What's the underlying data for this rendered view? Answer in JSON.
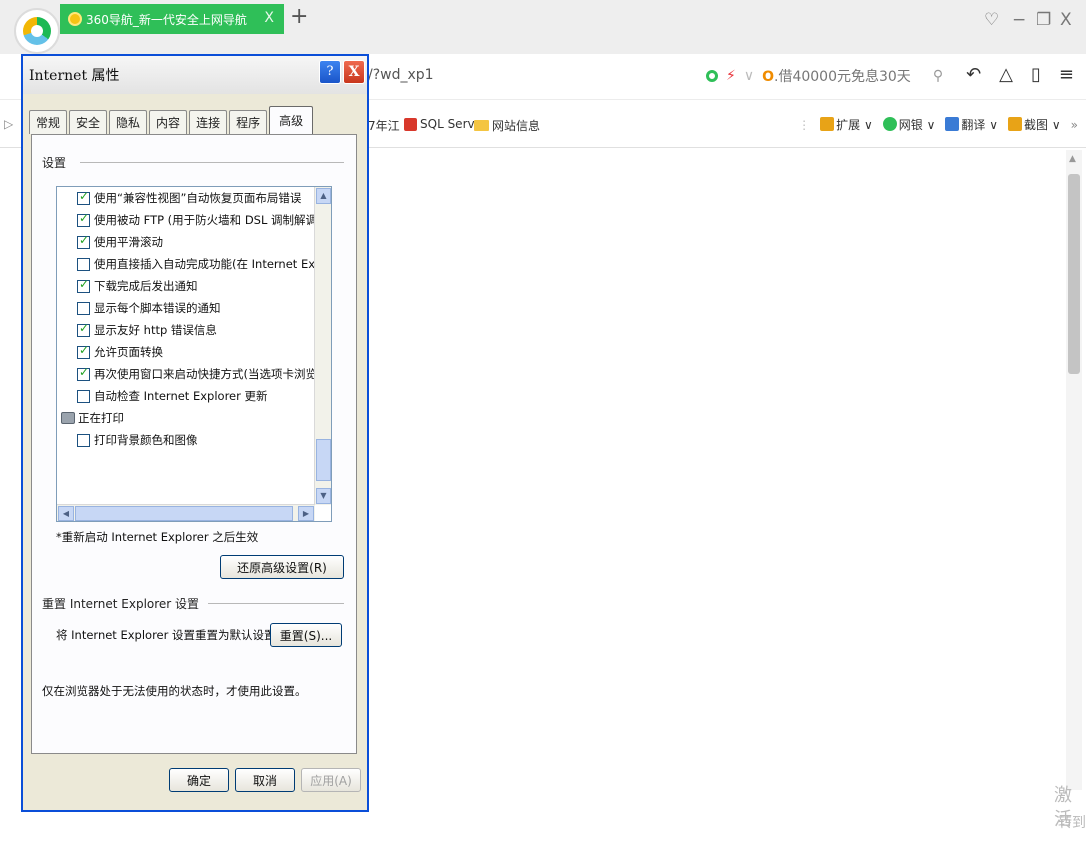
{
  "browser": {
    "tab_title": "360导航_新一代安全上网导航",
    "tab_close": "X",
    "new_tab": "+",
    "url_fragment": "/?wd_xp1",
    "ad_text": "借40000元免息30天",
    "window_controls": {
      "pin": "♡",
      "minimize": "−",
      "restore": "❐",
      "close": "X"
    },
    "toolbar_icons": [
      "undo-icon",
      "cloud-icon",
      "phone-icon",
      "menu-icon"
    ],
    "bookmarks": [
      {
        "label": "7年江",
        "icon": "text"
      },
      {
        "label": "SQL Serv",
        "icon": "sql-icon"
      },
      {
        "label": "网站信息",
        "icon": "folder-icon"
      }
    ],
    "bookmarks_right": [
      {
        "label": "扩展",
        "color": "#e8a317"
      },
      {
        "label": "网银",
        "color": "#2fbf58"
      },
      {
        "label": "翻译",
        "color": "#3a7bd5"
      },
      {
        "label": "截图",
        "color": "#e8a317"
      }
    ],
    "more": "»",
    "activate_line1": "激活",
    "activate_line2": "转到"
  },
  "dialog": {
    "title": "Internet 属性",
    "help_label": "?",
    "close_label": "X",
    "tabs": [
      "常规",
      "安全",
      "隐私",
      "内容",
      "连接",
      "程序",
      "高级"
    ],
    "active_tab": "高级",
    "settings_label": "设置",
    "settings_items": [
      {
        "label": "使用“兼容性视图”自动恢复页面布局错误",
        "checked": true,
        "type": "checkbox"
      },
      {
        "label": "使用被动 FTP (用于防火墙和 DSL 调制解调器的兼容",
        "checked": true,
        "type": "checkbox"
      },
      {
        "label": "使用平滑滚动",
        "checked": true,
        "type": "checkbox"
      },
      {
        "label": "使用直接插入自动完成功能(在 Internet Explorer 】",
        "checked": false,
        "type": "checkbox"
      },
      {
        "label": "下载完成后发出通知",
        "checked": true,
        "type": "checkbox"
      },
      {
        "label": "显示每个脚本错误的通知",
        "checked": false,
        "type": "checkbox"
      },
      {
        "label": "显示友好 http 错误信息",
        "checked": true,
        "type": "checkbox"
      },
      {
        "label": "允许页面转换",
        "checked": true,
        "type": "checkbox"
      },
      {
        "label": "再次使用窗口来启动快捷方式(当选项卡浏览关闭时)",
        "checked": true,
        "type": "checkbox"
      },
      {
        "label": "自动检查 Internet Explorer 更新",
        "checked": false,
        "type": "checkbox"
      },
      {
        "label": "正在打印",
        "checked": false,
        "type": "group"
      },
      {
        "label": "打印背景颜色和图像",
        "checked": false,
        "type": "checkbox"
      }
    ],
    "restart_note": "*重新启动 Internet Explorer 之后生效",
    "restore_button": "还原高级设置(R)",
    "reset_group_label": "重置 Internet Explorer 设置",
    "reset_description": "将 Internet Explorer 设置重置为默认设置。",
    "reset_button": "重置(S)...",
    "reset_warning": "仅在浏览器处于无法使用的状态时，才使用此设置。",
    "ok_button": "确定",
    "cancel_button": "取消",
    "apply_button": "应用(A)"
  }
}
